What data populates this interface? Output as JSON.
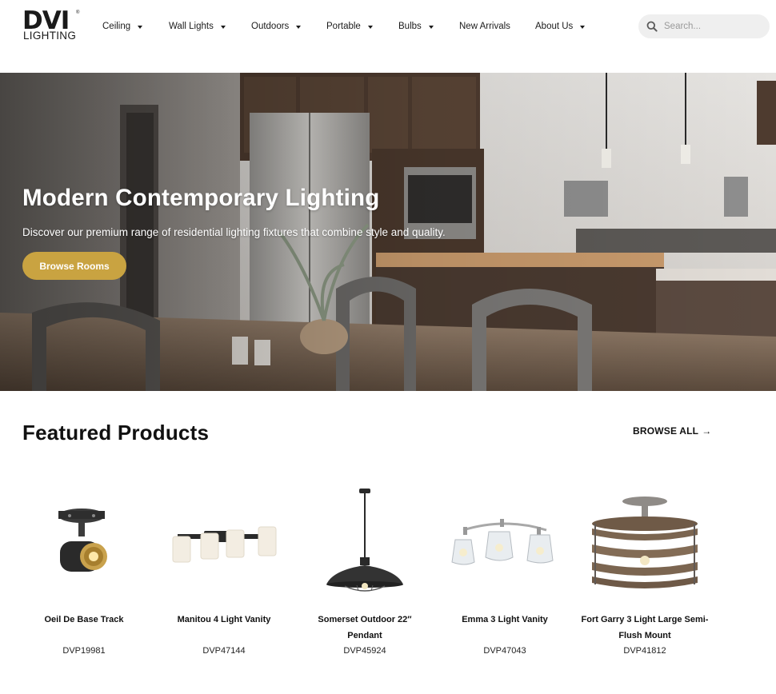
{
  "header": {
    "logo": {
      "main": "DVI",
      "sub": "LIGHTING",
      "registered": "®"
    },
    "nav": [
      {
        "label": "Ceiling",
        "dropdown": true
      },
      {
        "label": "Wall Lights",
        "dropdown": true
      },
      {
        "label": "Outdoors",
        "dropdown": true
      },
      {
        "label": "Portable",
        "dropdown": true
      },
      {
        "label": "Bulbs",
        "dropdown": true
      },
      {
        "label": "New Arrivals",
        "dropdown": false
      },
      {
        "label": "About Us",
        "dropdown": true
      }
    ],
    "search": {
      "placeholder": "Search...",
      "value": ""
    }
  },
  "hero": {
    "title": "Modern Contemporary Lighting",
    "subtitle": "Discover our premium range of residential lighting fixtures that combine style and quality.",
    "button_label": "Browse Rooms"
  },
  "featured": {
    "title": "Featured Products",
    "browse_all_label": "BROWSE ALL",
    "browse_all_arrow": "→",
    "products": [
      {
        "name": "Oeil De Base Track",
        "sku": "DVP19981",
        "icon": "track-light-icon"
      },
      {
        "name": "Manitou 4 Light Vanity",
        "sku": "DVP47144",
        "icon": "vanity-light-icon"
      },
      {
        "name": "Somerset Outdoor 22″ Pendant",
        "sku": "DVP45924",
        "icon": "pendant-light-icon"
      },
      {
        "name": "Emma 3 Light Vanity",
        "sku": "DVP47043",
        "icon": "vanity-light-icon"
      },
      {
        "name": "Fort Garry 3 Light Large Semi-Flush Mount",
        "sku": "DVP41812",
        "icon": "semi-flush-mount-icon"
      }
    ]
  },
  "colors": {
    "accent": "#c9a341",
    "text": "#111111",
    "search_bg": "#efefef"
  }
}
